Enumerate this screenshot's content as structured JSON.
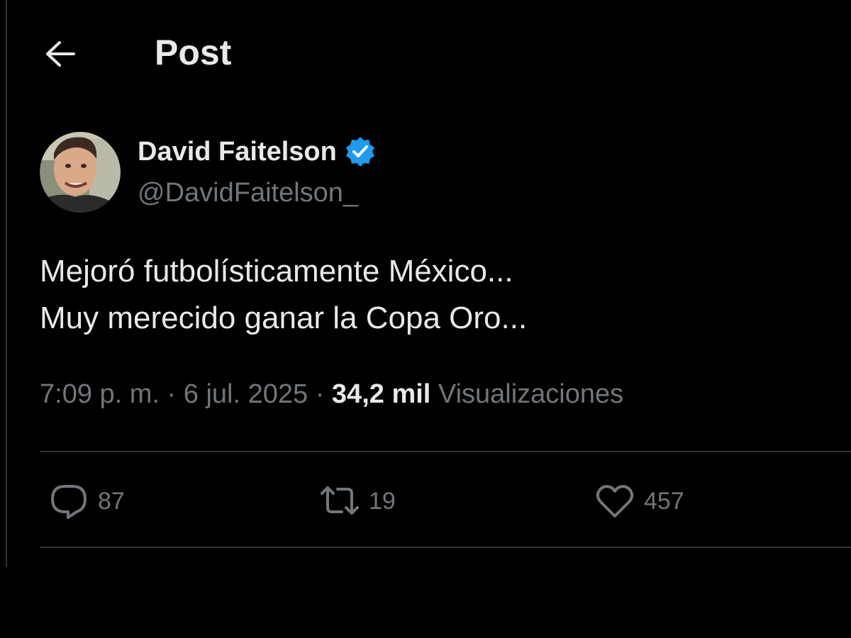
{
  "header": {
    "title": "Post",
    "back_icon": "arrow-left-icon"
  },
  "post": {
    "author": {
      "name": "David Faitelson",
      "handle": "@DavidFaitelson_",
      "verified": true,
      "verified_color": "#1d9bf0"
    },
    "text_lines": [
      "Mejoró futbolísticamente México...",
      "Muy merecido ganar la Copa Oro..."
    ],
    "time": "7:09 p. m.",
    "date": "6 jul. 2025",
    "separator": "·",
    "views_count": "34,2 mil",
    "views_label": "Visualizaciones",
    "stats": {
      "replies": "87",
      "reposts": "19",
      "likes": "457"
    }
  },
  "colors": {
    "background": "#000000",
    "text_primary": "#e7e9ea",
    "text_secondary": "#71767b",
    "border": "#2f3336",
    "accent": "#1d9bf0"
  }
}
